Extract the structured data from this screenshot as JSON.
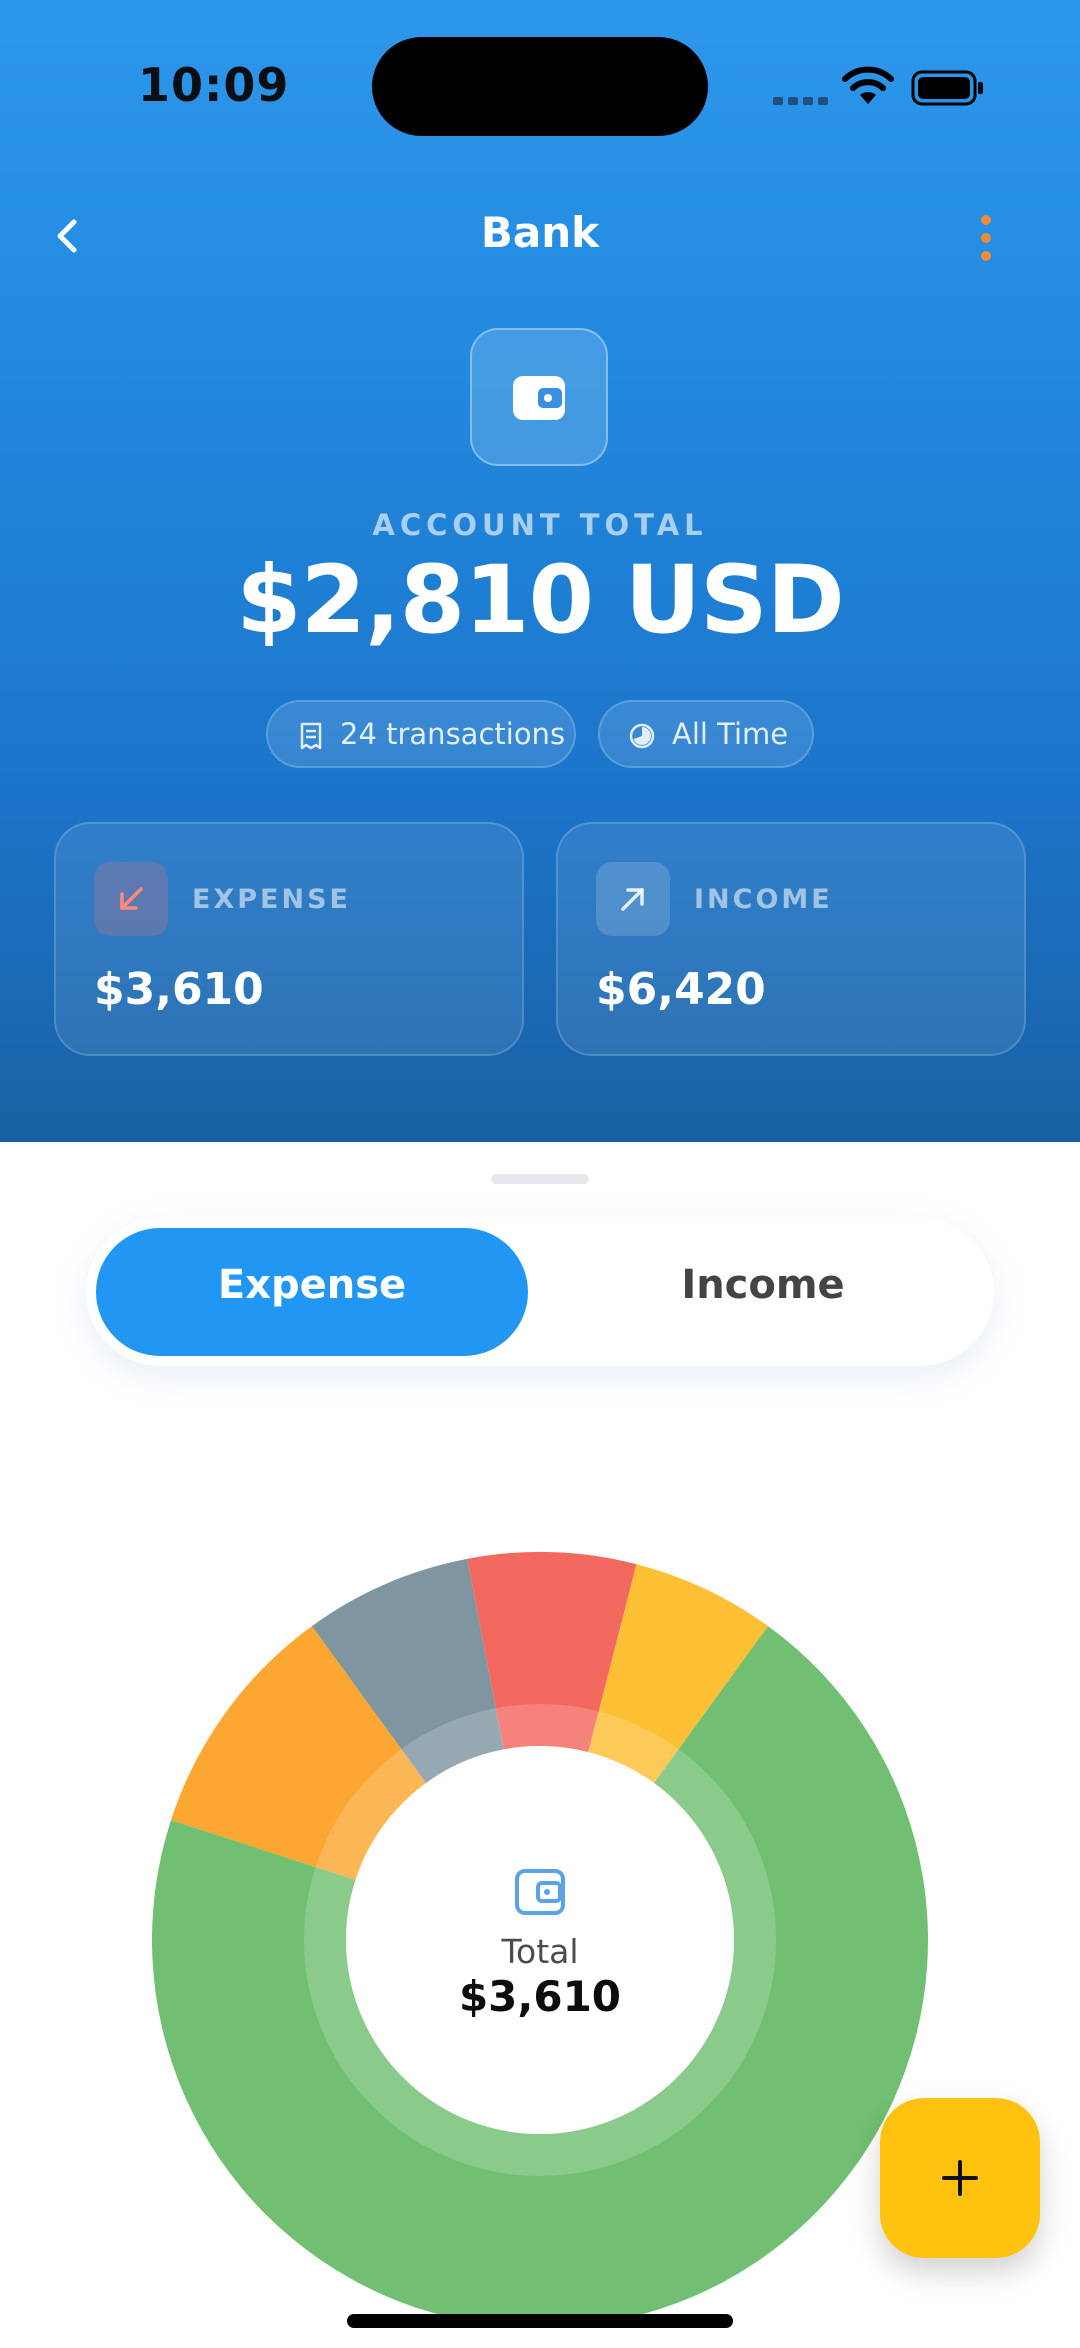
{
  "status_bar": {
    "time": "10:09"
  },
  "nav": {
    "title": "Bank",
    "back_icon": "chevron-left-icon",
    "more_icon": "more-vertical-icon",
    "more_color": "#f08a34"
  },
  "account": {
    "label": "ACCOUNT TOTAL",
    "total": "$2,810 USD",
    "transactions": "24 transactions",
    "period": "All Time"
  },
  "summary": {
    "expense": {
      "label": "EXPENSE",
      "value": "$3,610",
      "icon": "arrow-down-left-icon",
      "color": "#ff8a7a"
    },
    "income": {
      "label": "INCOME",
      "value": "$6,420",
      "icon": "arrow-up-right-icon"
    }
  },
  "tabs": {
    "expense": "Expense",
    "income": "Income",
    "active": "Expense"
  },
  "chart_center": {
    "label": "Total",
    "value": "$3,610"
  },
  "chart_data": {
    "type": "pie",
    "segments": [
      {
        "value": 10,
        "color": "#fba731"
      },
      {
        "value": 7,
        "color": "#7f96a1"
      },
      {
        "value": 7,
        "color": "#f3685f"
      },
      {
        "value": 6,
        "color": "#fdbf33"
      },
      {
        "value": 70,
        "color": "#71bf72"
      }
    ]
  },
  "colors": {
    "accent": "#2196f3",
    "fab": "#ffc30f"
  }
}
